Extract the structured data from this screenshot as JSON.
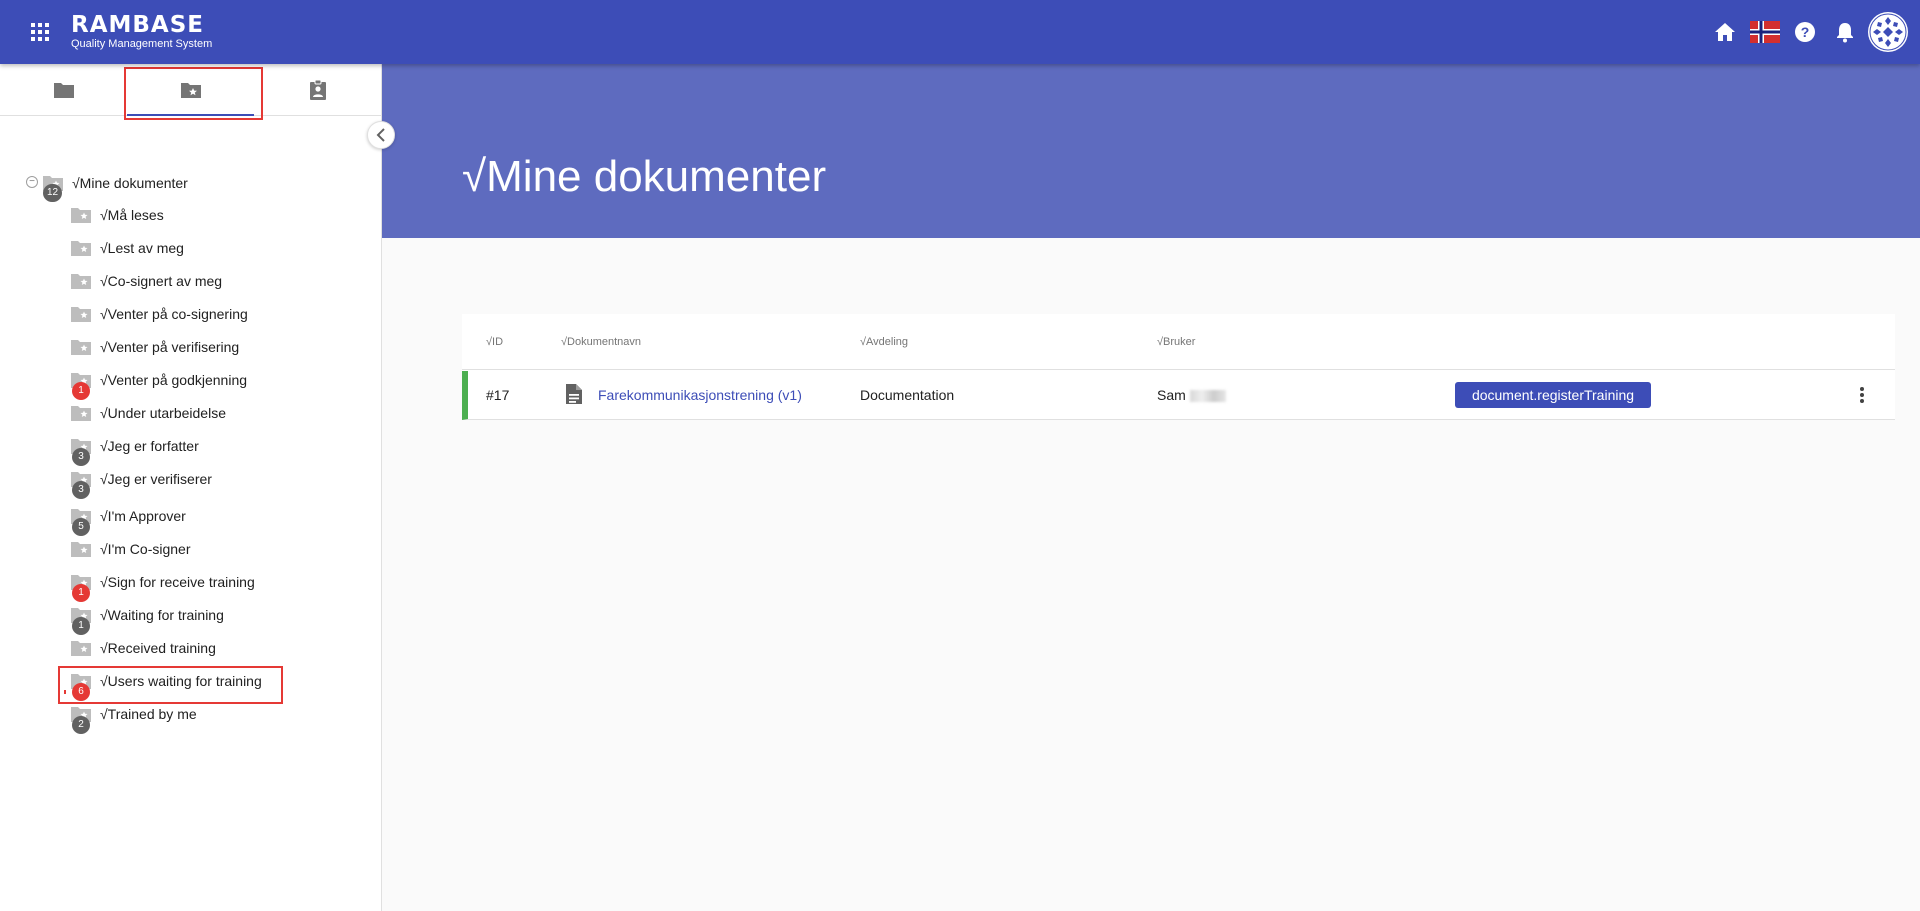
{
  "app": {
    "brand_name": "RAMBASE",
    "brand_sub": "Quality Management System"
  },
  "colors": {
    "primary": "#3d4db7",
    "hero": "#5e6bbf",
    "highlight": "#e53935",
    "badge_grey": "#616161",
    "badge_red": "#e53935",
    "row_accent": "#4caf50"
  },
  "topbar": {
    "icons": [
      "apps-icon",
      "home-icon",
      "norway-flag-icon",
      "help-icon",
      "bell-icon",
      "avatar"
    ]
  },
  "sidebar": {
    "tabs": [
      {
        "icon": "folder-icon",
        "active": false
      },
      {
        "icon": "starred-folder-icon",
        "active": true
      },
      {
        "icon": "assignment-ind-icon",
        "active": false
      }
    ],
    "root": {
      "label": "√Mine dokumenter",
      "badge": "12"
    },
    "items": [
      {
        "label": "√Må leses",
        "badge": ""
      },
      {
        "label": "√Lest av meg",
        "badge": ""
      },
      {
        "label": "√Co-signert av meg",
        "badge": ""
      },
      {
        "label": "√Venter på co-signering",
        "badge": ""
      },
      {
        "label": "√Venter på verifisering",
        "badge": ""
      },
      {
        "label": "√Venter på godkjenning",
        "badge": "1",
        "badge_color": "red"
      },
      {
        "label": "√Under utarbeidelse",
        "badge": ""
      },
      {
        "label": "√Jeg er forfatter",
        "badge": "3",
        "badge_color": "grey"
      },
      {
        "label": "√Jeg er verifiserer",
        "badge": "3",
        "badge_color": "grey"
      },
      {
        "label": "√I'm Approver",
        "badge": "5",
        "badge_color": "grey"
      },
      {
        "label": "√I'm Co-signer",
        "badge": ""
      },
      {
        "label": "√Sign for receive training",
        "badge": "1",
        "badge_color": "red"
      },
      {
        "label": "√Waiting for training",
        "badge": "1",
        "badge_color": "grey"
      },
      {
        "label": "√Received training",
        "badge": ""
      },
      {
        "label": "√Users waiting for training",
        "badge": "6",
        "badge_color": "red"
      },
      {
        "label": "√Trained by me",
        "badge": "2",
        "badge_color": "grey"
      }
    ]
  },
  "main": {
    "title": "√Mine dokumenter",
    "table": {
      "headers": [
        "√ID",
        "√Dokumentnavn",
        "√Avdeling",
        "√Bruker"
      ],
      "rows": [
        {
          "id": "#17",
          "name": "Farekommunikasjonstrening (v1)",
          "department": "Documentation",
          "user": "Sam",
          "action": "document.registerTraining"
        }
      ]
    }
  }
}
